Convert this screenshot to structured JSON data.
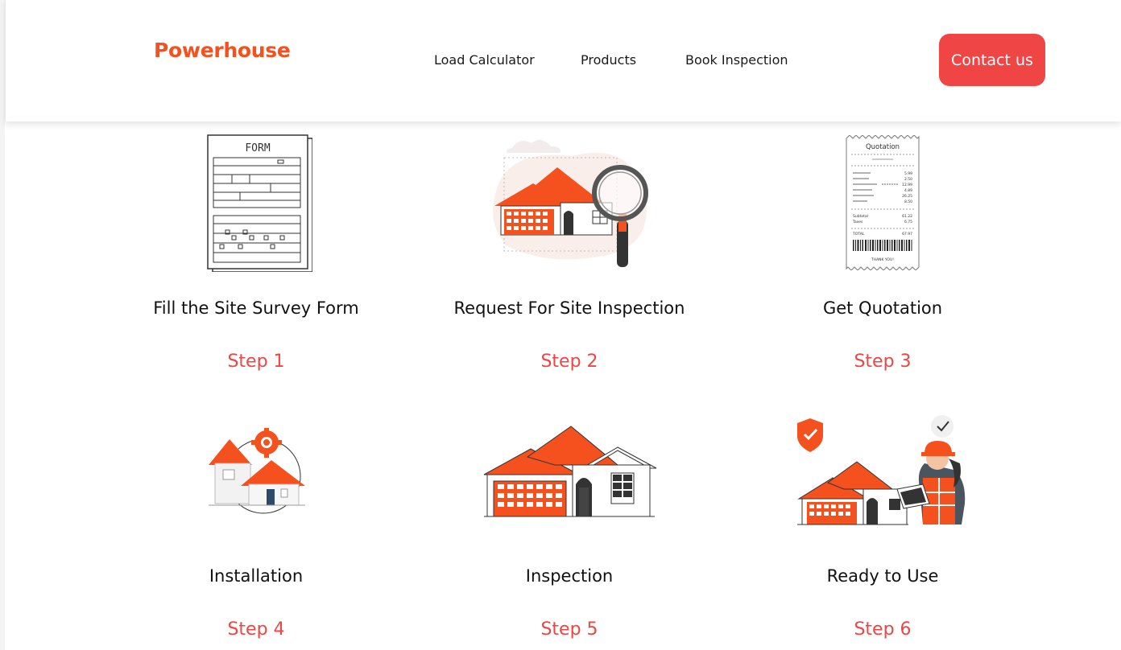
{
  "brand": {
    "name": "Powerhouse"
  },
  "nav": {
    "links": [
      {
        "label": "Load Calculator"
      },
      {
        "label": "Products"
      },
      {
        "label": "Book Inspection"
      }
    ],
    "contact_label": "Contact us"
  },
  "colors": {
    "accent": "#f4511e",
    "button": "#f04545",
    "step_text": "#ee4545",
    "text": "#111111"
  },
  "steps": [
    {
      "title": "Fill the Site Survey Form",
      "step": "Step 1",
      "icon": "form-illustration",
      "form_heading": "FORM"
    },
    {
      "title": "Request For Site Inspection",
      "step": "Step 2",
      "icon": "house-magnifier-illustration"
    },
    {
      "title": "Get Quotation",
      "step": "Step 3",
      "icon": "receipt-illustration",
      "receipt": {
        "heading": "Quotation",
        "values": [
          "5.99",
          "2.50",
          "12.99",
          "4.89",
          "26.25",
          "8.50"
        ],
        "subtotal_label": "Subtotal",
        "subtotal": "61.22",
        "taxes_label": "Taxes",
        "taxes": "6.75",
        "total_label": "TOTAL",
        "total": "67.97",
        "thanks": "THANK YOU!"
      }
    },
    {
      "title": "Installation",
      "step": "Step 4",
      "icon": "house-gear-illustration"
    },
    {
      "title": "Inspection",
      "step": "Step 5",
      "icon": "house-illustration"
    },
    {
      "title": "Ready to Use",
      "step": "Step 6",
      "icon": "worker-house-illustration"
    }
  ]
}
